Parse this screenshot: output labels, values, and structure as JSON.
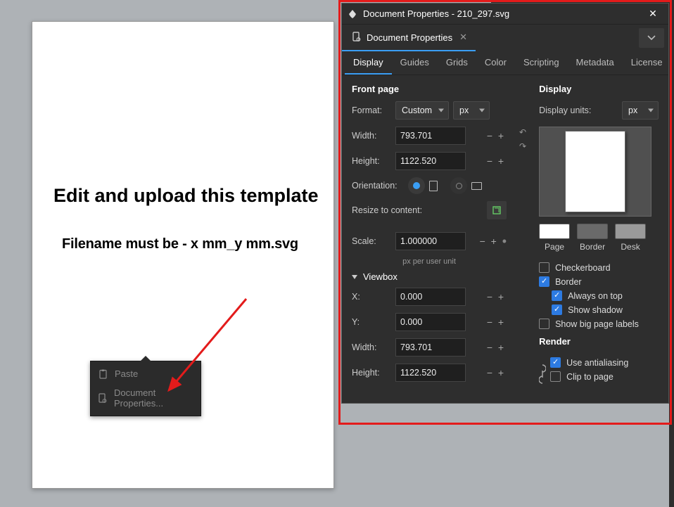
{
  "canvas": {
    "title_text": "Edit and upload this template",
    "sub_text": "Filename must be - x mm_y mm.svg"
  },
  "context_menu": {
    "paste": "Paste",
    "docprops": "Document Properties..."
  },
  "dialog": {
    "title": "Document Properties - 210_297.svg",
    "tab_label": "Document Properties",
    "subtabs": {
      "display": "Display",
      "guides": "Guides",
      "grids": "Grids",
      "color": "Color",
      "scripting": "Scripting",
      "metadata": "Metadata",
      "license": "License"
    },
    "frontpage_heading": "Front page",
    "format_label": "Format:",
    "format_value": "Custom",
    "format_unit": "px",
    "width_label": "Width:",
    "width_value": "793.701",
    "height_label": "Height:",
    "height_value": "1122.520",
    "orientation_label": "Orientation:",
    "resize_label": "Resize to content:",
    "scale_label": "Scale:",
    "scale_value": "1.000000",
    "scale_hint": "px per user unit",
    "viewbox_heading": "Viewbox",
    "vb_x_label": "X:",
    "vb_x_value": "0.000",
    "vb_y_label": "Y:",
    "vb_y_value": "0.000",
    "vb_w_label": "Width:",
    "vb_w_value": "793.701",
    "vb_h_label": "Height:",
    "vb_h_value": "1122.520",
    "display_heading": "Display",
    "display_units_label": "Display units:",
    "display_units_value": "px",
    "swatches": {
      "page": "Page",
      "border": "Border",
      "desk": "Desk"
    },
    "checks": {
      "checkerboard": "Checkerboard",
      "border": "Border",
      "always_top": "Always on top",
      "shadow": "Show shadow",
      "big_labels": "Show big page labels"
    },
    "render_heading": "Render",
    "render": {
      "antialias": "Use antialiasing",
      "clip": "Clip to page"
    }
  }
}
